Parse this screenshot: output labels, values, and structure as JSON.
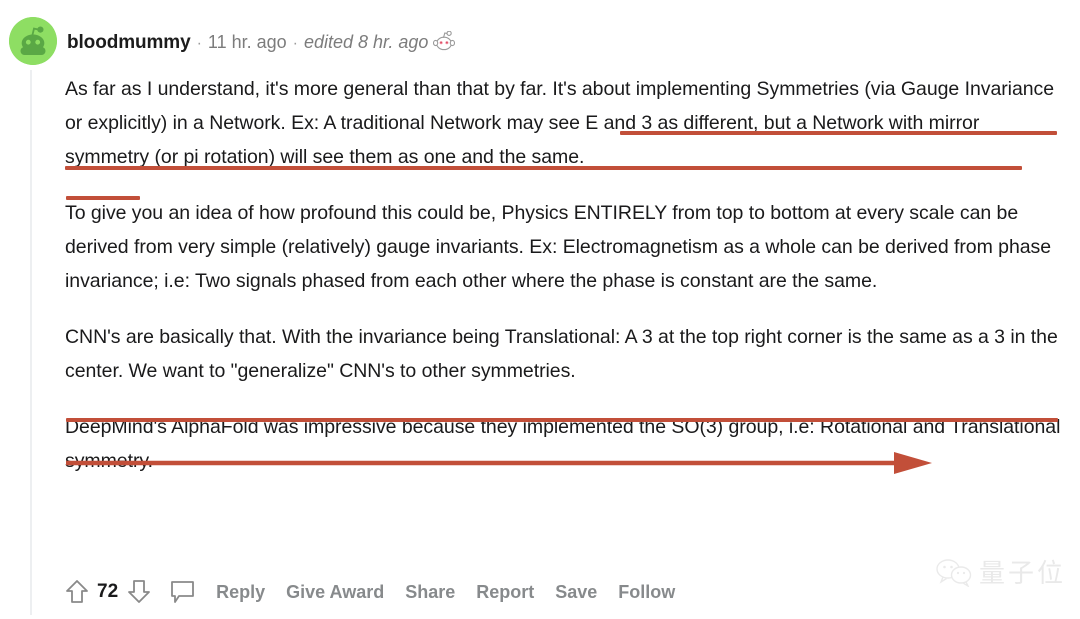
{
  "post": {
    "author": "bloodmummy",
    "separator": "·",
    "age": "11 hr. ago",
    "edited": "edited 8 hr. ago",
    "avatar_color": "#8ede63",
    "paragraphs": [
      "As far as I understand, it's more general than that by far. It's about implementing Symmetries (via Gauge Invariance or explicitly) in a Network. Ex: A traditional Network may see E and 3 as different, but a Network with mirror symmetry (or pi rotation) will see them as one and the same.",
      "To give you an idea of how profound this could be, Physics ENTIRELY from top to bottom at every scale can be derived from very simple (relatively) gauge invariants. Ex: Electromagnetism as a whole can be derived from phase invariance; i.e: Two signals phased from each other where the phase is constant are the same.",
      "CNN's are basically that. With the invariance being Translational: A 3 at the top right corner is the same as a 3 in the center. We want to \"generalize\" CNN's to other symmetries.",
      "DeepMind's AlphaFold was impressive because they implemented the SO(3) group, i.e: Rotational and Translational symmetry."
    ]
  },
  "annotations": {
    "color": "#c24f39",
    "marks": [
      {
        "type": "underline",
        "text": "A traditional Network may see E and 3 as"
      },
      {
        "type": "underline",
        "text": "different, but a Network with mirror symmetry (or pi rotation) will see them as one and the"
      },
      {
        "type": "underline",
        "text": "same."
      },
      {
        "type": "underline",
        "text": "CNN's are basically that. With the invariance being Translational: A 3 at the top right corner is"
      },
      {
        "type": "arrow",
        "text": "the same as a 3 in the center. We want to \"generalize\" CNN's to other symmetries."
      }
    ]
  },
  "actions": {
    "score": "72",
    "upvote_label": "upvote",
    "downvote_label": "downvote",
    "links": [
      "Reply",
      "Give Award",
      "Share",
      "Report",
      "Save",
      "Follow"
    ]
  },
  "watermark": {
    "text": "量子位"
  }
}
